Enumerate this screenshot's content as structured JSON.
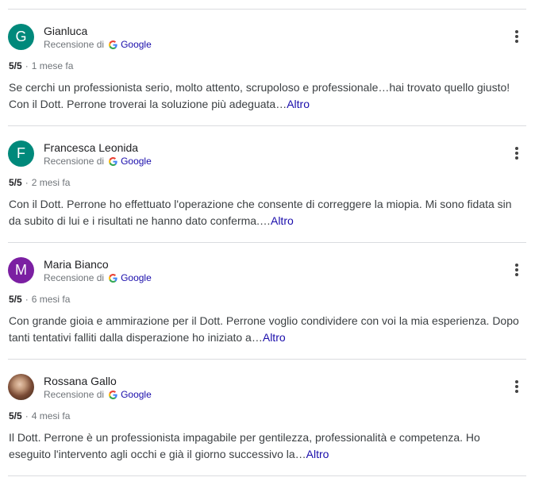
{
  "reviews": [
    {
      "name": "Gianluca",
      "avatar_letter": "G",
      "avatar_color": "#00897b",
      "source_prefix": "Recensione di",
      "source_name": "Google",
      "rating": "5/5",
      "time": "1 mese fa",
      "text": "Se cerchi un professionista serio, molto attento, scrupoloso e professionale…hai trovato quello giusto! Con il Dott. Perrone troverai la soluzione più adeguata…",
      "more_label": "Altro"
    },
    {
      "name": "Francesca Leonida",
      "avatar_letter": "F",
      "avatar_color": "#00897b",
      "source_prefix": "Recensione di",
      "source_name": "Google",
      "rating": "5/5",
      "time": "2 mesi fa",
      "text": "Con il Dott. Perrone ho effettuato l'operazione che consente di correggere la miopia. Mi sono fidata sin da subito di lui e i risultati ne hanno dato conferma.…",
      "more_label": "Altro"
    },
    {
      "name": "Maria Bianco",
      "avatar_letter": "M",
      "avatar_color": "#7b1fa2",
      "source_prefix": "Recensione di",
      "source_name": "Google",
      "rating": "5/5",
      "time": "6 mesi fa",
      "text": "Con grande gioia e ammirazione per il Dott. Perrone voglio condividere con voi la mia esperienza. Dopo tanti tentativi falliti dalla disperazione ho iniziato a…",
      "more_label": "Altro"
    },
    {
      "name": "Rossana Gallo",
      "avatar_letter": "",
      "avatar_color": "#8d6e63",
      "source_prefix": "Recensione di",
      "source_name": "Google",
      "rating": "5/5",
      "time": "4 mesi fa",
      "text": "Il Dott. Perrone è un professionista impagabile per gentilezza, professionalità e competenza. Ho eseguito l'intervento agli occhi e già il giorno successivo la…",
      "more_label": "Altro"
    }
  ],
  "icons": {
    "menu": "more-vert-icon",
    "google": "google-g-icon"
  },
  "colors": {
    "link": "#1a0dab",
    "divider": "#dadce0",
    "meta": "#70757a"
  }
}
